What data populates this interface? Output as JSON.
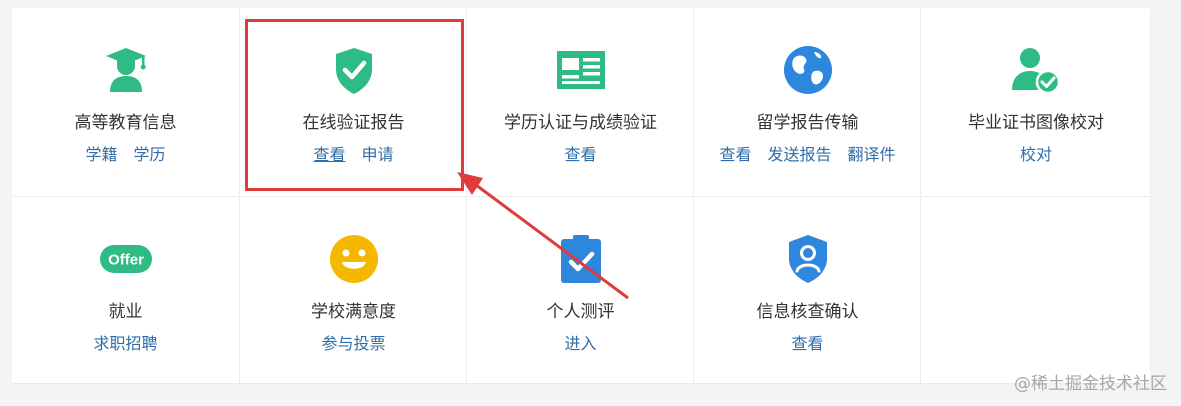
{
  "colors": {
    "green": "#2ebc84",
    "blue": "#2f86dd",
    "yellow": "#f5b800",
    "link": "#2f6ea8",
    "highlight": "#e03b3b"
  },
  "items": [
    {
      "title": "高等教育信息",
      "icon": "graduate-icon",
      "links": [
        "学籍",
        "学历"
      ]
    },
    {
      "title": "在线验证报告",
      "icon": "shield-check-icon",
      "links": [
        "查看",
        "申请"
      ]
    },
    {
      "title": "学历认证与成绩验证",
      "icon": "id-card-icon",
      "links": [
        "查看"
      ]
    },
    {
      "title": "留学报告传输",
      "icon": "globe-icon",
      "links": [
        "查看",
        "发送报告",
        "翻译件"
      ]
    },
    {
      "title": "毕业证书图像校对",
      "icon": "user-check-icon",
      "links": [
        "校对"
      ]
    },
    {
      "title": "就业",
      "icon": "offer-icon",
      "icon_text": "Offer",
      "links": [
        "求职招聘"
      ]
    },
    {
      "title": "学校满意度",
      "icon": "smile-icon",
      "links": [
        "参与投票"
      ]
    },
    {
      "title": "个人测评",
      "icon": "clipboard-check-icon",
      "links": [
        "进入"
      ]
    },
    {
      "title": "信息核查确认",
      "icon": "user-shield-icon",
      "links": [
        "查看"
      ]
    }
  ],
  "watermark": "@稀土掘金技术社区"
}
